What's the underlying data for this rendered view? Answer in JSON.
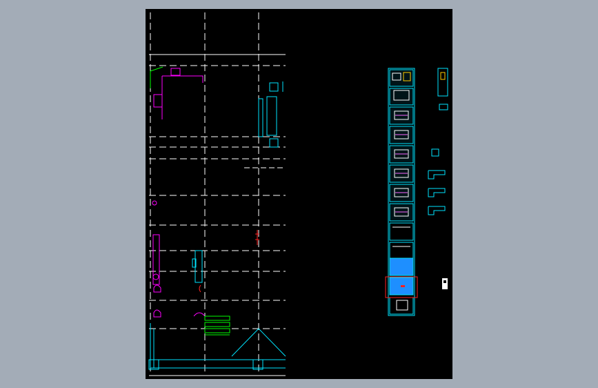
{
  "app": {
    "viewport_label": "",
    "colors": {
      "background": "#a3acb7",
      "canvas": "#000000",
      "grid": "#ffffff",
      "cyan": "#00e5ff",
      "magenta": "#ff00ff",
      "green": "#00ff00",
      "red": "#ff2020",
      "selection": "#1e8fff"
    },
    "icons": [
      "drawing-thumbnail-icon",
      "sheet-marker-icon",
      "selection-box-icon"
    ]
  },
  "drawing": {
    "sheet_count": 13,
    "selected_sheet_index": 11,
    "highlighted_sheet_indices": [
      10,
      11
    ]
  }
}
